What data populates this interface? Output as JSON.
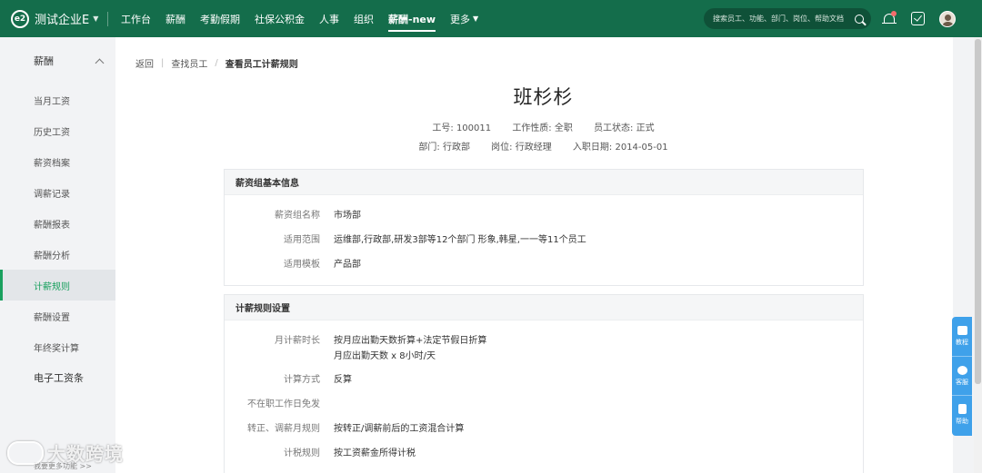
{
  "topbar": {
    "brand": "测试企业E",
    "nav": [
      "工作台",
      "薪酬",
      "考勤假期",
      "社保公积金",
      "人事",
      "组织",
      "薪酬-new",
      "更多"
    ],
    "active_nav": "薪酬-new",
    "search_placeholder": "搜索员工、功能、部门、岗位、帮助文档"
  },
  "sidebar": {
    "group": "薪酬",
    "items": [
      "当月工资",
      "历史工资",
      "薪资档案",
      "调薪记录",
      "薪酬报表",
      "薪酬分析",
      "计薪规则",
      "薪酬设置",
      "年终奖计算",
      "电子工资条"
    ],
    "active_item": "计薪规则",
    "footer": "我要更多功能 >>"
  },
  "breadcrumb": {
    "back": "返回",
    "parent": "查找员工",
    "current": "查看员工计薪规则"
  },
  "employee": {
    "name": "班杉杉",
    "id_label": "工号:",
    "id": "100011",
    "nature_label": "工作性质:",
    "nature": "全职",
    "status_label": "员工状态:",
    "status": "正式",
    "dept_label": "部门:",
    "dept": "行政部",
    "position_label": "岗位:",
    "position": "行政经理",
    "hire_label": "入职日期:",
    "hire_date": "2014-05-01"
  },
  "basic_info": {
    "title": "薪资组基本信息",
    "fields": [
      {
        "label": "薪资组名称",
        "value": "市场部"
      },
      {
        "label": "适用范围",
        "value": "运维部,行政部,研发3部等12个部门 形象,韩星,一一等11个员工"
      },
      {
        "label": "适用模板",
        "value": "产品部"
      }
    ]
  },
  "rule_settings": {
    "title": "计薪规则设置",
    "fields": [
      {
        "label": "月计薪时长",
        "value": "按月应出勤天数折算+法定节假日折算",
        "value2": "月应出勤天数 x 8小时/天"
      },
      {
        "label": "计算方式",
        "value": "反算"
      },
      {
        "label": "不在职工作日免发",
        "value": ""
      },
      {
        "label": "转正、调薪月规则",
        "value": "按转正/调薪前后的工资混合计算"
      },
      {
        "label": "计税规则",
        "value": "按工资薪金所得计税"
      }
    ]
  },
  "float_tools": [
    "教程",
    "客服",
    "帮助"
  ],
  "watermark": "大数跨境"
}
